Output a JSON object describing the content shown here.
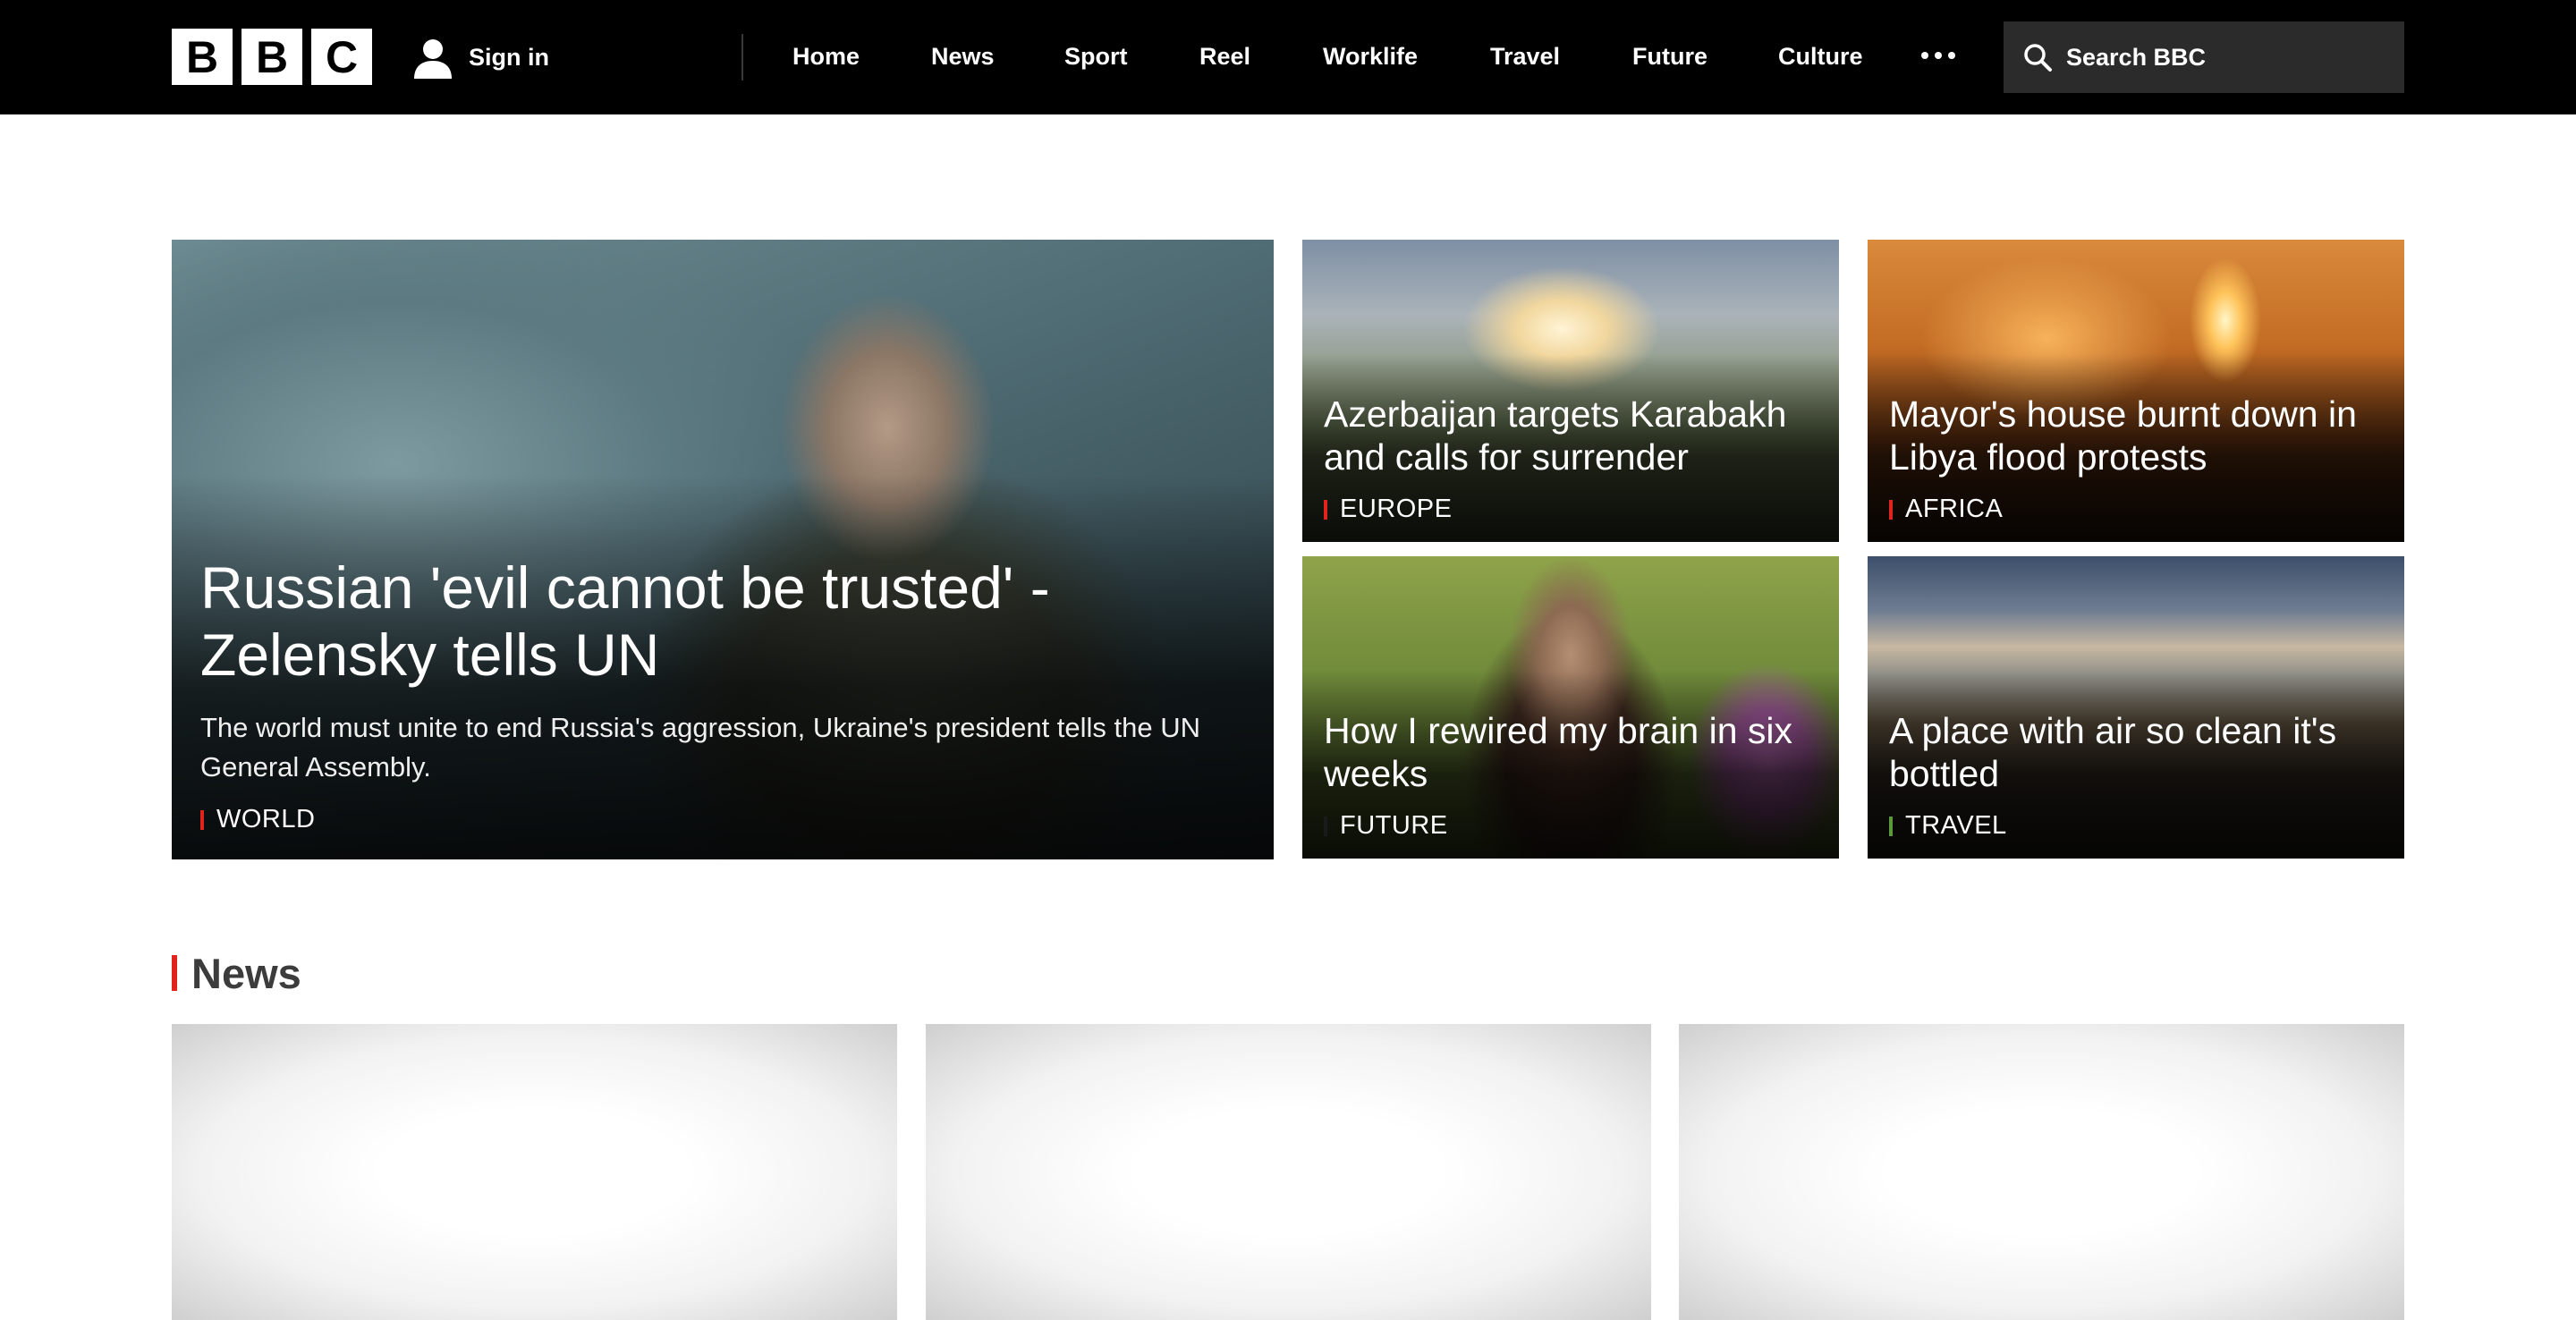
{
  "header": {
    "logo_letters": [
      "B",
      "B",
      "C"
    ],
    "signin_label": "Sign in",
    "nav": [
      {
        "label": "Home"
      },
      {
        "label": "News"
      },
      {
        "label": "Sport"
      },
      {
        "label": "Reel"
      },
      {
        "label": "Worklife"
      },
      {
        "label": "Travel"
      },
      {
        "label": "Future"
      },
      {
        "label": "Culture"
      }
    ],
    "more_icon": "more-dots-icon",
    "search": {
      "placeholder": "Search BBC",
      "icon": "search-icon"
    }
  },
  "hero": {
    "title": "Russian 'evil cannot be trusted' - Zelensky tells UN",
    "summary": "The world must unite to end Russia's aggression, Ukraine's president tells the UN General Assembly.",
    "tag": "WORLD",
    "tag_color": "#e0231c"
  },
  "stories": [
    {
      "title": "Azerbaijan targets Karabakh and calls for surrender",
      "tag": "EUROPE",
      "tag_color": "#e0231c"
    },
    {
      "title": "Mayor's house burnt down in Libya flood protests",
      "tag": "AFRICA",
      "tag_color": "#e0231c"
    },
    {
      "title": "How I rewired my brain in six weeks",
      "tag": "FUTURE",
      "tag_color": "#1a1a1a"
    },
    {
      "title": "A place with air so clean it's bottled",
      "tag": "TRAVEL",
      "tag_color": "#5a9a3a"
    }
  ],
  "news_section": {
    "title": "News",
    "accent": "#e0231c"
  }
}
